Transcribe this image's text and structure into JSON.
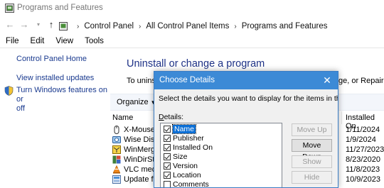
{
  "window": {
    "title": "Programs and Features"
  },
  "address_bar": {
    "crumbs": [
      "Control Panel",
      "All Control Panel Items",
      "Programs and Features"
    ]
  },
  "menu": [
    "File",
    "Edit",
    "View",
    "Tools"
  ],
  "left_pane": {
    "home": "Control Panel Home",
    "updates": "View installed updates",
    "features_line1": "Turn Windows features on or",
    "features_line2": "off"
  },
  "main": {
    "title": "Uninstall or change a program",
    "desc_left": "To uninst",
    "desc_right": "ge, or Repair.",
    "organize": "Organize",
    "col_name": "Name",
    "col_installed": "Installed On",
    "programs": [
      {
        "name": "X-Mouse E",
        "date": "1/11/2024"
      },
      {
        "name": "Wise Disk C",
        "date": "1/9/2024"
      },
      {
        "name": "WinMerge",
        "date": "11/27/2023"
      },
      {
        "name": "WinDirStat",
        "date": "8/23/2020"
      },
      {
        "name": "VLC media",
        "date": "11/8/2023"
      },
      {
        "name": "Update for",
        "date": "10/9/2023"
      }
    ]
  },
  "dialog": {
    "title": "Choose Details",
    "description": "Select the details you want to display for the items in this folder.",
    "details_label": "Details:",
    "details_label_accel": "D",
    "details_label_rest": "etails:",
    "items": [
      {
        "label": "Name",
        "checked": true,
        "selected": true
      },
      {
        "label": "Publisher",
        "checked": true,
        "selected": false
      },
      {
        "label": "Installed On",
        "checked": true,
        "selected": false
      },
      {
        "label": "Size",
        "checked": true,
        "selected": false
      },
      {
        "label": "Version",
        "checked": true,
        "selected": false
      },
      {
        "label": "Location",
        "checked": true,
        "selected": false
      },
      {
        "label": "Comments",
        "checked": false,
        "selected": false
      }
    ],
    "buttons": {
      "move_up": "Move Up",
      "move_down": "Move Down",
      "show": "Show",
      "hide": "Hide"
    }
  }
}
